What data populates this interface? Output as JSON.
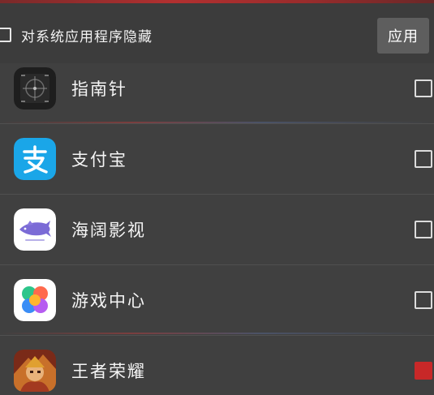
{
  "header": {
    "hide_system_label": "对系统应用程序隐藏",
    "hide_system_checked": false,
    "apply_label": "应用"
  },
  "apps": [
    {
      "name": "指南针",
      "icon": "compass-icon",
      "checked": false
    },
    {
      "name": "支付宝",
      "icon": "alipay-icon",
      "checked": false
    },
    {
      "name": "海阔影视",
      "icon": "haikuo-video-icon",
      "checked": false
    },
    {
      "name": "游戏中心",
      "icon": "game-center-icon",
      "checked": false
    },
    {
      "name": "王者荣耀",
      "icon": "honor-of-kings-icon",
      "checked": true
    }
  ],
  "colors": {
    "background": "#404040",
    "checked": "#c82828",
    "alipay_blue": "#1aa6e8",
    "apply_button": "#5e5e5e"
  }
}
